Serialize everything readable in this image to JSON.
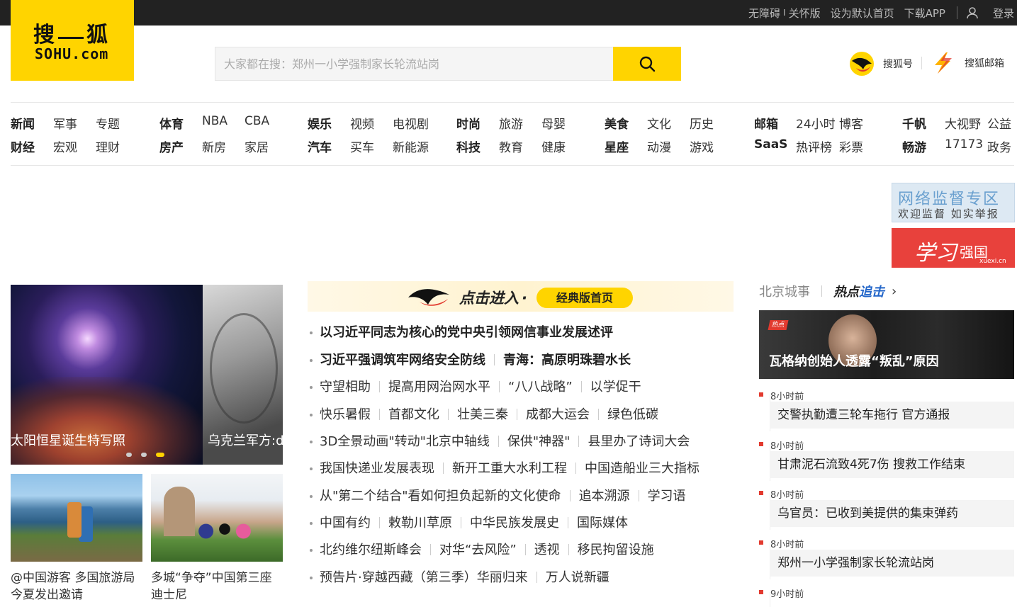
{
  "topbar": {
    "accessibility": "无障碍",
    "separator": "I",
    "care_mode": "关怀版",
    "set_home": "设为默认首页",
    "download_app": "下载APP",
    "login": "登录"
  },
  "logo": {
    "cn_left": "搜",
    "cn_right": "狐",
    "en": "SOHU.com"
  },
  "search": {
    "placeholder": "大家都在搜：郑州一小学强制家长轮流站岗"
  },
  "header_links": {
    "sohuhao": "搜狐号",
    "mail": "搜狐邮箱"
  },
  "nav": {
    "row1": [
      "新闻",
      "军事",
      "专题",
      "体育",
      "NBA",
      "CBA",
      "娱乐",
      "视频",
      "电视剧",
      "时尚",
      "旅游",
      "母婴",
      "美食",
      "文化",
      "历史",
      "邮箱",
      "24小时",
      "博客",
      "千帆",
      "大视野",
      "公益"
    ],
    "row2": [
      "财经",
      "宏观",
      "理财",
      "房产",
      "新房",
      "家居",
      "汽车",
      "买车",
      "新能源",
      "科技",
      "教育",
      "健康",
      "星座",
      "动漫",
      "游戏",
      "SaaS",
      "热评榜",
      "彩票",
      "畅游",
      "17173",
      "政务"
    ]
  },
  "ads": {
    "report_title": "网络监督专区",
    "report_sub": "欢迎监督 如实举报",
    "xuexi_script": "学习",
    "xuexi_title": "强国",
    "xuexi_url": "xuexi.cn"
  },
  "hero": {
    "caption1": "太阳恒星诞生特写照",
    "caption2": "乌克兰军方:d"
  },
  "thumbs": [
    {
      "caption": "@中国游客 多国旅游局今夏发出邀请"
    },
    {
      "caption": "多城“争夺”中国第三座迪士尼"
    }
  ],
  "banner": {
    "enter": "点击进入",
    "dot": "·",
    "classic": "经典版首页"
  },
  "news": {
    "l1": "以习近平同志为核心的党中央引领网信事业发展述评",
    "l2a": "习近平强调筑牢网络安全防线",
    "l2b": "青海：高原明珠碧水长",
    "l3": [
      "守望相助",
      "提高用网治网水平",
      "“八八战略”",
      "以学促干"
    ],
    "l4": [
      "快乐暑假",
      "首都文化",
      "壮美三秦",
      "成都大运会",
      "绿色低碳"
    ],
    "l5": [
      "3D全景动画\"转动\"北京中轴线",
      "保供\"神器\"",
      "县里办了诗词大会"
    ],
    "l6": [
      "我国快递业发展表现",
      "新开工重大水利工程",
      "中国造船业三大指标"
    ],
    "l7": [
      "从\"第二个结合\"看如何担负起新的文化使命",
      "追本溯源",
      "学习语"
    ],
    "l8": [
      "中国有约",
      "敕勒川草原",
      "中华民族发展史",
      "国际媒体"
    ],
    "l9": [
      "北约维尔纽斯峰会",
      "对华“去风险”",
      "透视",
      "移民拘留设施"
    ],
    "l10": [
      "预告片·穿越西藏（第三季）华丽归来",
      "万人说新疆"
    ]
  },
  "right": {
    "tab_city": "北京城事",
    "tab_hot_a": "热点",
    "tab_hot_b": "追击",
    "chev": "›",
    "hero_tag": "热点",
    "hero_caption": "瓦格纳创始人透露“叛乱”原因",
    "items": [
      {
        "time": "8小时前",
        "title": "交警执勤遭三轮车拖行 官方通报"
      },
      {
        "time": "8小时前",
        "title": "甘肃泥石流致4死7伤 搜救工作结束"
      },
      {
        "time": "8小时前",
        "title": "乌官员：已收到美提供的集束弹药"
      },
      {
        "time": "8小时前",
        "title": "郑州一小学强制家长轮流站岗"
      },
      {
        "time": "9小时前",
        "title": ""
      }
    ]
  }
}
